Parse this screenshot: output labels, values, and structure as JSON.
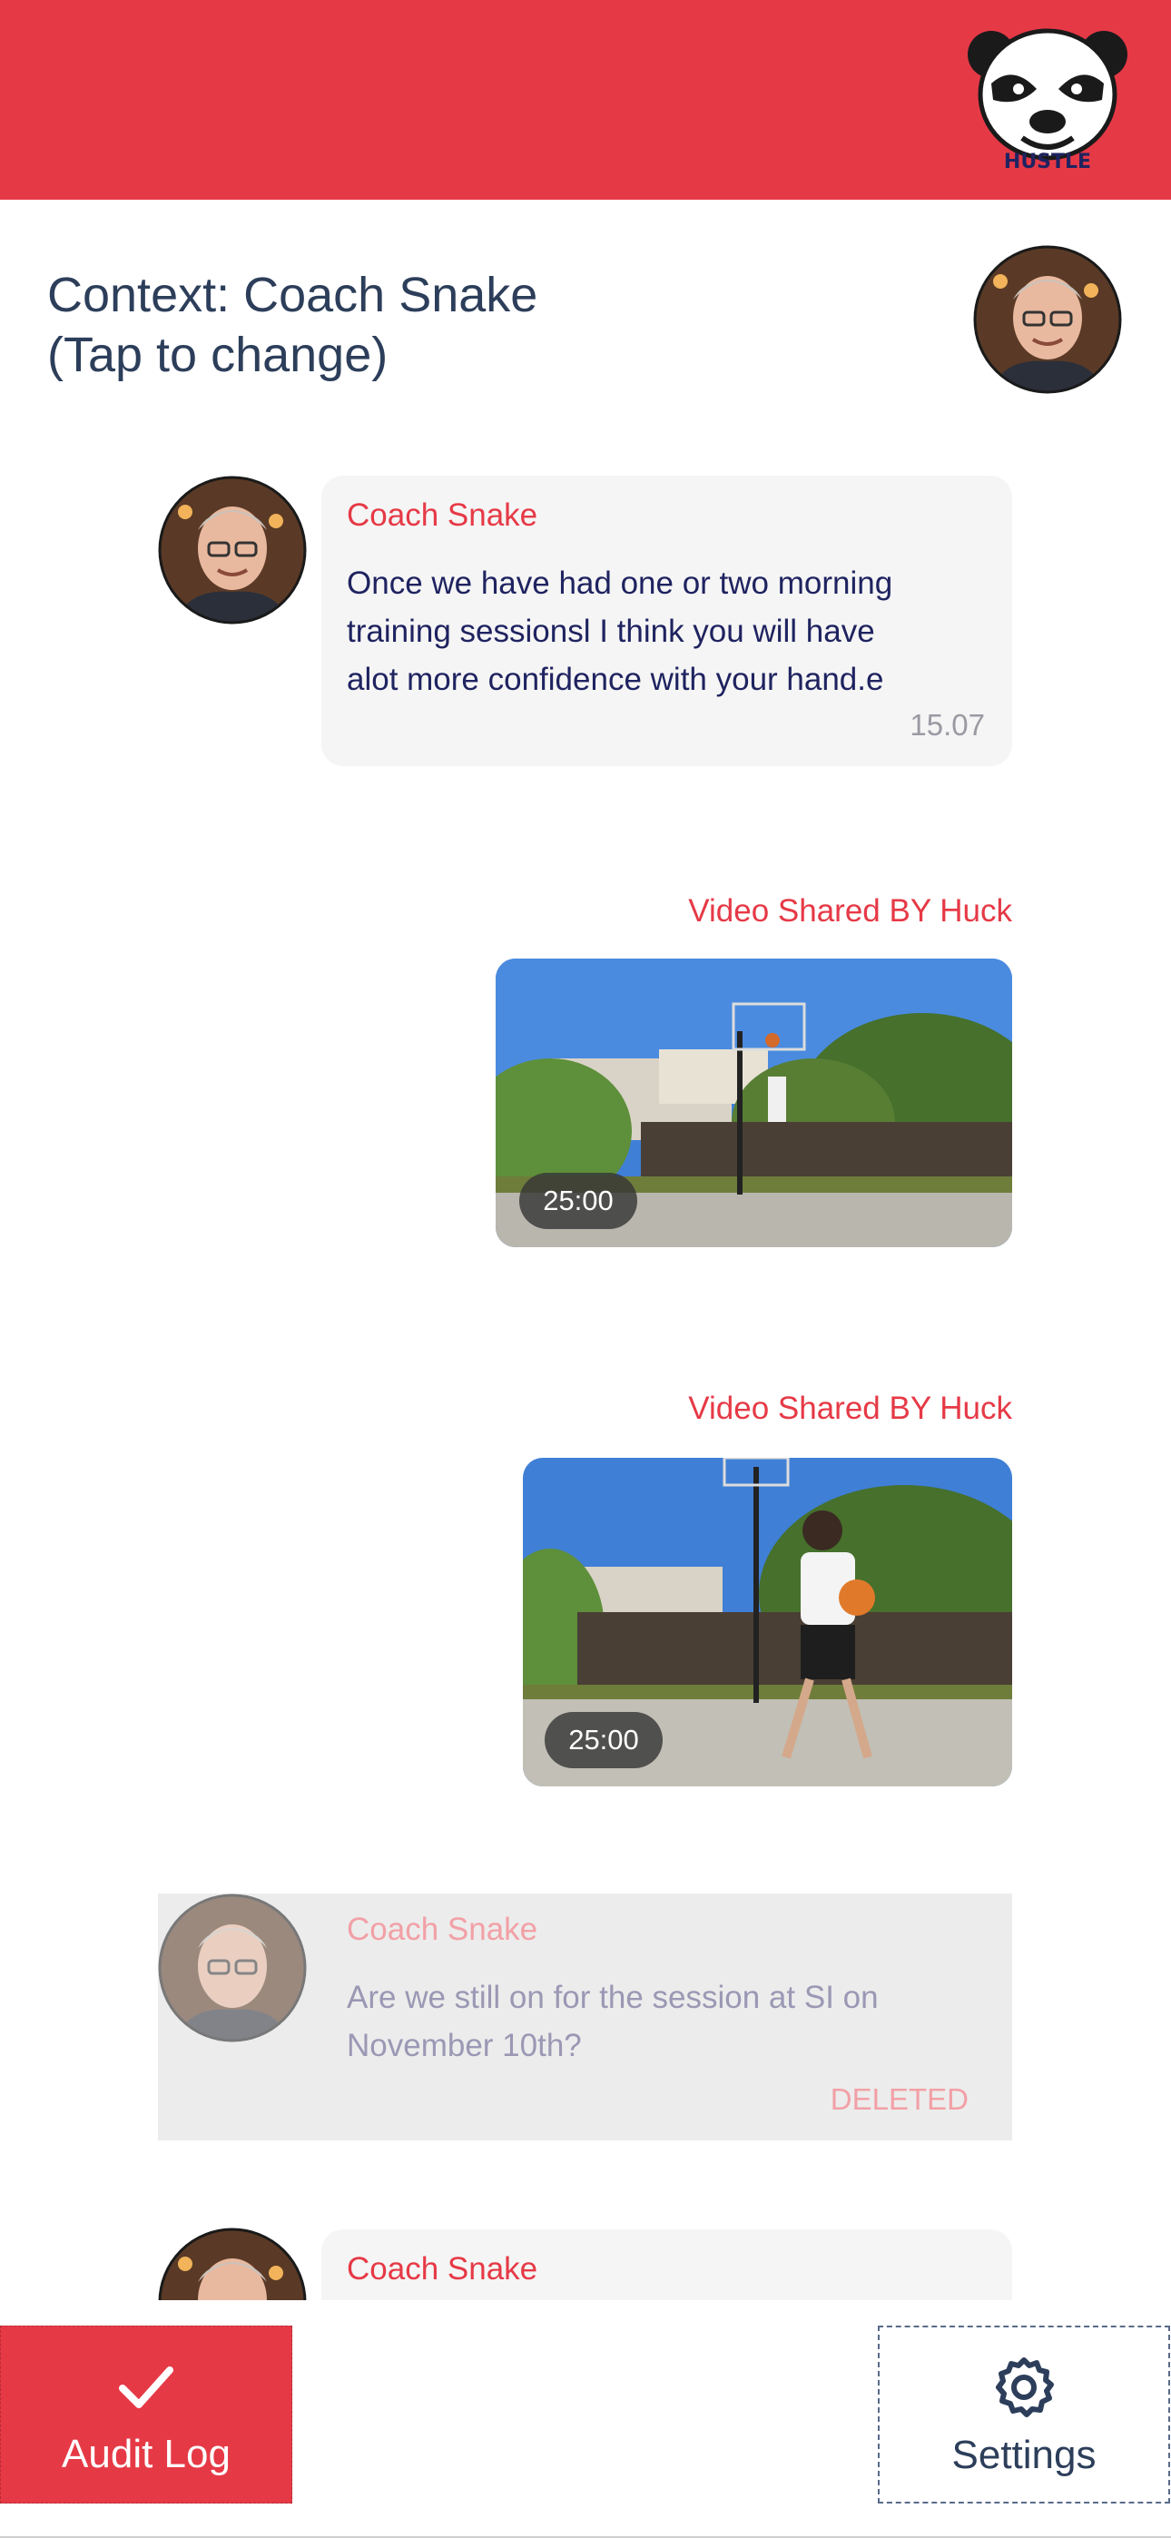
{
  "header": {
    "logo_text": "HUSTLE",
    "color": "#e63946"
  },
  "context": {
    "line1": "Context: Coach Snake",
    "line2": "(Tap to change)"
  },
  "messages": [
    {
      "sender": "Coach Snake",
      "text_lines": [
        "Once we have had one or two morning",
        "training sessionsl I think you will have",
        "alot more confidence with your hand.e"
      ],
      "time": "15.07"
    },
    {
      "label": "Video Shared BY Huck",
      "duration": "25:00"
    },
    {
      "label": "Video Shared BY Huck",
      "duration": "25:00"
    },
    {
      "sender": "Coach Snake",
      "text_lines": [
        "Are we still on for the session at SI on",
        "November 10th?"
      ],
      "status": "DELETED"
    },
    {
      "sender": "Coach Snake"
    }
  ],
  "footer": {
    "audit_label": "Audit Log",
    "audit_icon": "checkmark-icon",
    "settings_label": "Settings",
    "settings_icon": "gear-icon"
  },
  "colors": {
    "accent": "#e63946",
    "bubble": "#f5f5f5",
    "deleted_bg": "#ececec",
    "text_dark": "#1f2360"
  }
}
